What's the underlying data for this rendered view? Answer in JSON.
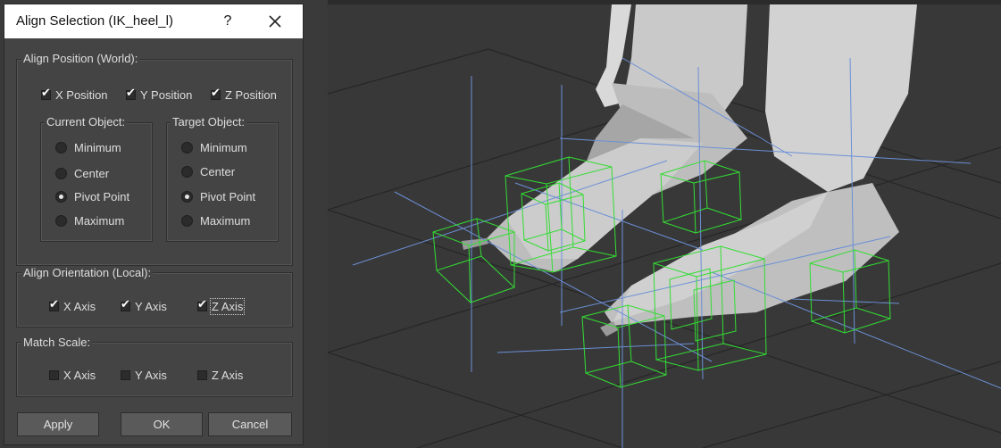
{
  "dialog": {
    "title": "Align Selection (IK_heel_l)",
    "help_label": "?",
    "close_icon": "close-icon"
  },
  "align_position": {
    "label": "Align Position (World):",
    "x": {
      "label": "X Position",
      "checked": true
    },
    "y": {
      "label": "Y Position",
      "checked": true
    },
    "z": {
      "label": "Z Position",
      "checked": true
    },
    "current_object": {
      "label": "Current Object:",
      "options": [
        "Minimum",
        "Center",
        "Pivot Point",
        "Maximum"
      ],
      "selected": "Pivot Point"
    },
    "target_object": {
      "label": "Target Object:",
      "options": [
        "Minimum",
        "Center",
        "Pivot Point",
        "Maximum"
      ],
      "selected": "Pivot Point"
    }
  },
  "align_orientation": {
    "label": "Align Orientation (Local):",
    "x": {
      "label": "X Axis",
      "checked": true
    },
    "y": {
      "label": "Y Axis",
      "checked": true
    },
    "z": {
      "label": "Z Axis",
      "checked": true
    }
  },
  "match_scale": {
    "label": "Match Scale:",
    "x": {
      "label": "X Axis",
      "checked": false
    },
    "y": {
      "label": "Y Axis",
      "checked": false
    },
    "z": {
      "label": "Z Axis",
      "checked": false
    }
  },
  "buttons": {
    "apply": "Apply",
    "ok": "OK",
    "cancel": "Cancel"
  },
  "check_glyph": "✔",
  "colors": {
    "viewport_bg": "#383838",
    "grid": "#262626",
    "helper_box": "#33dd33",
    "axis_line": "#6b8fd6",
    "mesh": "#bfbfbf"
  }
}
